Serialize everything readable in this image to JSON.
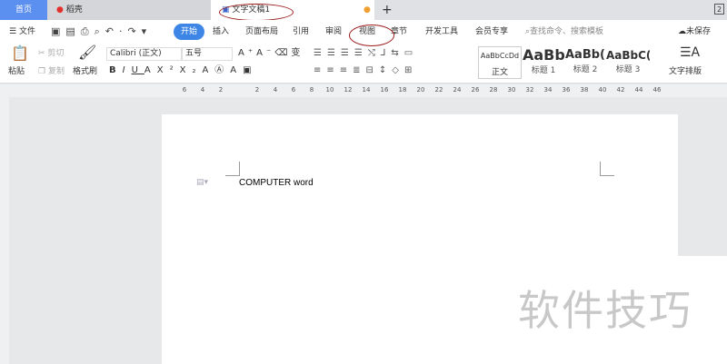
{
  "tabs": {
    "home": "首页",
    "daoke": "稻壳",
    "doc": "文字文稿1",
    "new_tab": "+",
    "window_num": "2"
  },
  "menu": {
    "file": "文件",
    "items": [
      "开始",
      "插入",
      "页面布局",
      "引用",
      "审阅",
      "视图",
      "章节",
      "开发工具",
      "会员专享"
    ],
    "search_placeholder": "查找命令、搜索模板",
    "unsaved": "未保存"
  },
  "toolbar": {
    "paste": "粘贴",
    "cut": "剪切",
    "copy": "复制",
    "format_painter": "格式刷",
    "font": "Calibri (正文)",
    "size": "五号",
    "text_layout": "文字排版"
  },
  "styles": [
    {
      "preview": "AaBbCcDd",
      "label": "正文"
    },
    {
      "preview": "AaBb",
      "label": "标题 1"
    },
    {
      "preview": "AaBb(",
      "label": "标题 2"
    },
    {
      "preview": "AaBbC(",
      "label": "标题 3"
    }
  ],
  "ruler": [
    "6",
    "4",
    "2",
    "2",
    "4",
    "6",
    "8",
    "10",
    "12",
    "14",
    "16",
    "18",
    "20",
    "22",
    "24",
    "26",
    "28",
    "30",
    "32",
    "34",
    "36",
    "38",
    "40",
    "42",
    "44",
    "46"
  ],
  "document": {
    "text": "COMPUTER word"
  },
  "watermark": "软件技巧",
  "colors": {
    "accent": "#3d86e6",
    "annotation": "#9b1c1c"
  }
}
